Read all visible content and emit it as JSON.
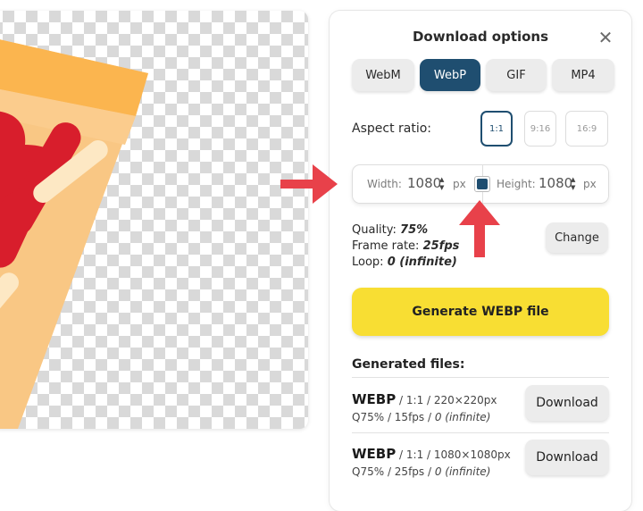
{
  "panel": {
    "title": "Download options",
    "close_glyph": "✕"
  },
  "formats": [
    {
      "label": "WebM",
      "active": false
    },
    {
      "label": "WebP",
      "active": true
    },
    {
      "label": "GIF",
      "active": false
    },
    {
      "label": "MP4",
      "active": false
    }
  ],
  "aspect": {
    "label": "Aspect ratio:",
    "options": [
      "1:1",
      "9:16",
      "16:9"
    ],
    "selected": "1:1"
  },
  "dimensions": {
    "width_label": "Width:",
    "width_value": "1080",
    "height_label": "Height:",
    "height_value": "1080",
    "unit": "px",
    "spin_up": "▲",
    "spin_down": "▼"
  },
  "stats": {
    "quality_label": "Quality:",
    "quality_value": "75%",
    "framerate_label": "Frame rate:",
    "framerate_value": "25fps",
    "loop_label": "Loop:",
    "loop_value": "0 (infinite)"
  },
  "change_label": "Change",
  "generate_label": "Generate WEBP file",
  "generated_title": "Generated files:",
  "files": [
    {
      "format": "WEBP",
      "ratio": "1:1",
      "size": "220×220px",
      "quality": "Q75%",
      "fps": "15fps",
      "loop": "0 (infinite)",
      "download_label": "Download"
    },
    {
      "format": "WEBP",
      "ratio": "1:1",
      "size": "1080×1080px",
      "quality": "Q75%",
      "fps": "25fps",
      "loop": "0 (infinite)",
      "download_label": "Download"
    }
  ],
  "colors": {
    "accent": "#1f4e70",
    "generate_button": "#f8de33",
    "annotation_arrow": "#e8414a"
  },
  "icons": [
    "close-icon",
    "lock-aspect-icon",
    "spinner-icon",
    "arrow-right-annotation",
    "arrow-up-annotation"
  ]
}
